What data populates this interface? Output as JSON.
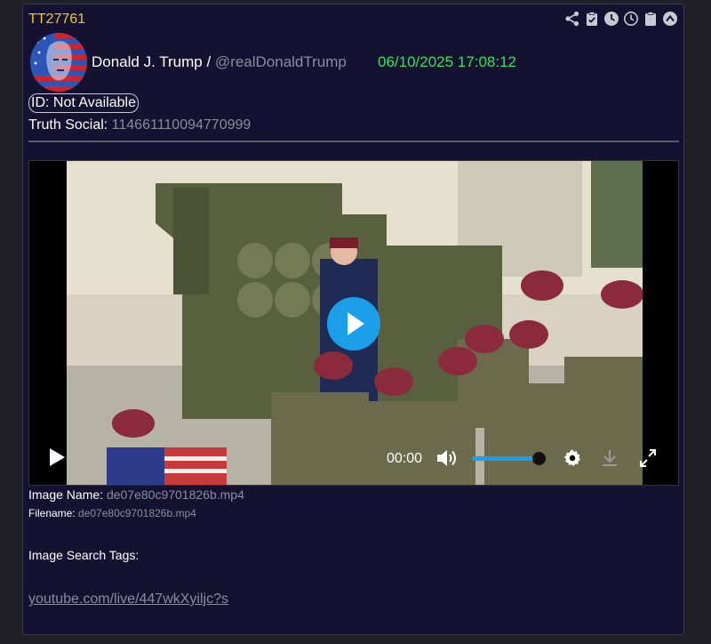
{
  "post": {
    "id": "TT27761",
    "author_name": "Donald J. Trump",
    "separator": " / ",
    "handle": "@realDonaldTrump",
    "timestamp": "06/10/2025 17:08:12",
    "id_status": "ID: Not Available",
    "truth_label": "Truth Social: ",
    "truth_id": "114661110094770999"
  },
  "toolbar": {
    "icons": [
      "share-icon",
      "clipboard-check-icon",
      "clock-filled-icon",
      "clock-outline-icon",
      "clipboard-icon",
      "chevron-up-circle-icon"
    ]
  },
  "video": {
    "time": "00:00",
    "volume_level": 0.9,
    "controls": [
      "play-icon",
      "volume-icon",
      "settings-gear-icon",
      "download-icon",
      "fullscreen-icon"
    ]
  },
  "media": {
    "image_name_label": "Image Name: ",
    "image_name": "de07e80c9701826b.mp4",
    "filename_label": "Filename: ",
    "filename": "de07e80c9701826b.mp4",
    "tags_label": "Image Search Tags:",
    "source_link": "youtube.com/live/447wkXyiljc?s"
  },
  "colors": {
    "card_bg": "#151130",
    "post_id": "#f3c71f",
    "timestamp": "#2fe35e",
    "accent": "#1a9fe8",
    "muted": "#8c8ca0"
  }
}
